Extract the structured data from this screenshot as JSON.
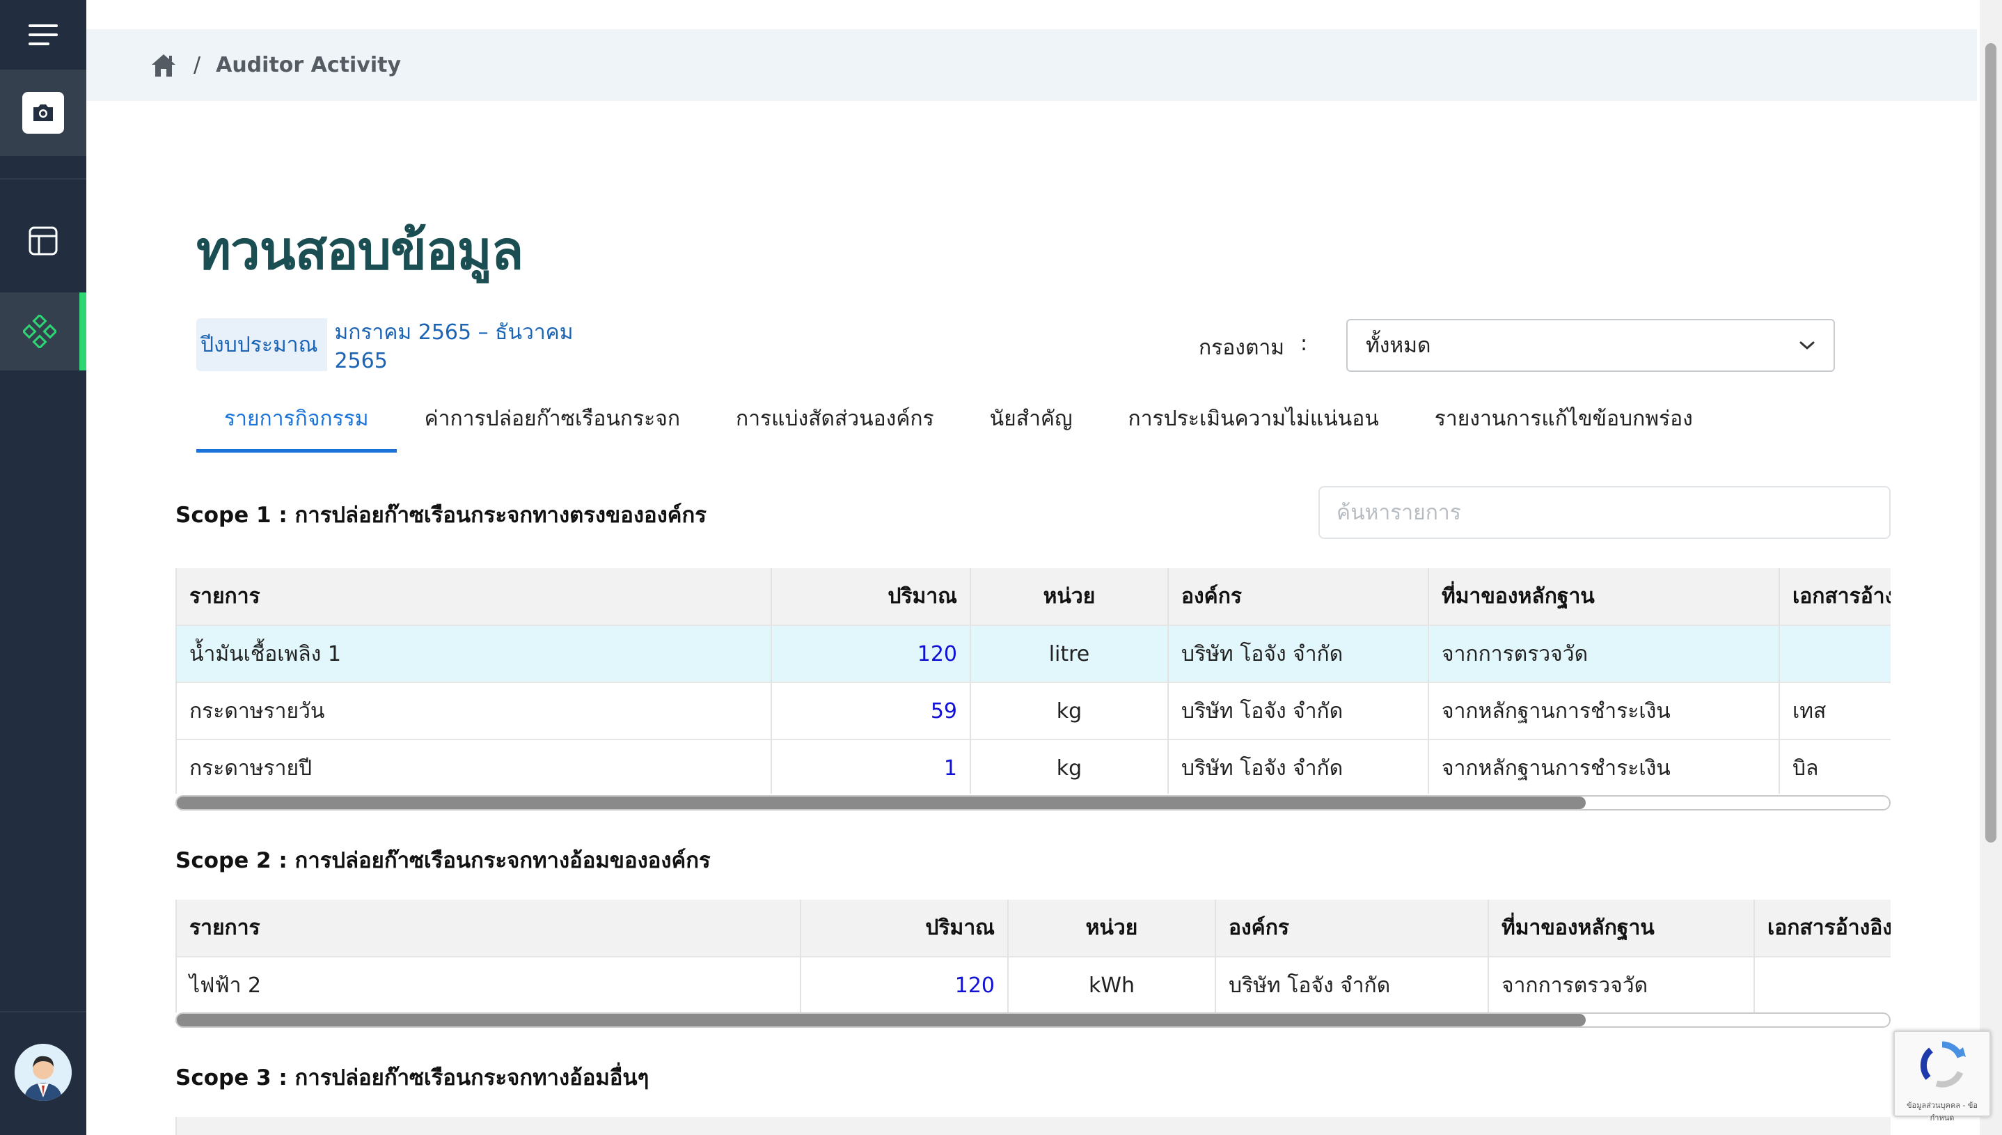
{
  "breadcrumb": {
    "separator": "/",
    "current": "Auditor Activity"
  },
  "page": {
    "title": "ทวนสอบข้อมูล",
    "budget_label": "ปีงบประมาณ",
    "budget_value": "มกราคม 2565 – ธันวาคม 2565",
    "filter_label": "กรองตาม",
    "filter_colon": ":",
    "filter_value": "ทั้งหมด"
  },
  "tabs": [
    {
      "label": "รายการกิจกรรม",
      "active": true
    },
    {
      "label": "ค่าการปล่อยก๊าซเรือนกระจก",
      "active": false
    },
    {
      "label": "การแบ่งสัดส่วนองค์กร",
      "active": false
    },
    {
      "label": "นัยสำคัญ",
      "active": false
    },
    {
      "label": "การประเมินความไม่แน่นอน",
      "active": false
    },
    {
      "label": "รายงานการแก้ไขข้อบกพร่อง",
      "active": false
    }
  ],
  "search": {
    "placeholder": "ค้นหารายการ"
  },
  "scope1": {
    "title": "Scope 1 : การปล่อยก๊าซเรือนกระจกทางตรงขององค์กร",
    "headers": [
      "รายการ",
      "ปริมาณ",
      "หน่วย",
      "องค์กร",
      "ที่มาของหลักฐาน",
      "เอกสารอ้างอิง"
    ],
    "rows": [
      [
        "น้ำมันเชื้อเพลิง 1",
        "120",
        "litre",
        "บริษัท โอจัง จำกัด",
        "จากการตรวจวัด",
        ""
      ],
      [
        "กระดาษรายวัน",
        "59",
        "kg",
        "บริษัท โอจัง จำกัด",
        "จากหลักฐานการชำระเงิน",
        "เทส"
      ],
      [
        "กระดาษรายปี",
        "1",
        "kg",
        "บริษัท โอจัง จำกัด",
        "จากหลักฐานการชำระเงิน",
        "บิล"
      ]
    ]
  },
  "scope2": {
    "title": "Scope 2 : การปล่อยก๊าซเรือนกระจกทางอ้อมขององค์กร",
    "headers": [
      "รายการ",
      "ปริมาณ",
      "หน่วย",
      "องค์กร",
      "ที่มาของหลักฐาน",
      "เอกสารอ้างอิง"
    ],
    "rows": [
      [
        "ไฟฟ้า 2",
        "120",
        "kWh",
        "บริษัท โอจัง จำกัด",
        "จากการตรวจวัด",
        ""
      ]
    ]
  },
  "scope3": {
    "title": "Scope 3 : การปล่อยก๊าซเรือนกระจกทางอ้อมอื่นๆ"
  },
  "recaptcha": {
    "text": "ข้อมูลส่วนบุคคล - ข้อกำหนด"
  },
  "colors": {
    "sidebar": "#222e40",
    "active_accent": "#2ed573",
    "title": "#1b4e52",
    "link": "#1a73d9",
    "highlight_row": "#e2f7fc"
  },
  "icons": [
    "menu-icon",
    "camera-icon",
    "layout-icon",
    "diamond-grid-icon",
    "avatar",
    "home-icon",
    "chevron-down-icon",
    "recaptcha-icon"
  ]
}
